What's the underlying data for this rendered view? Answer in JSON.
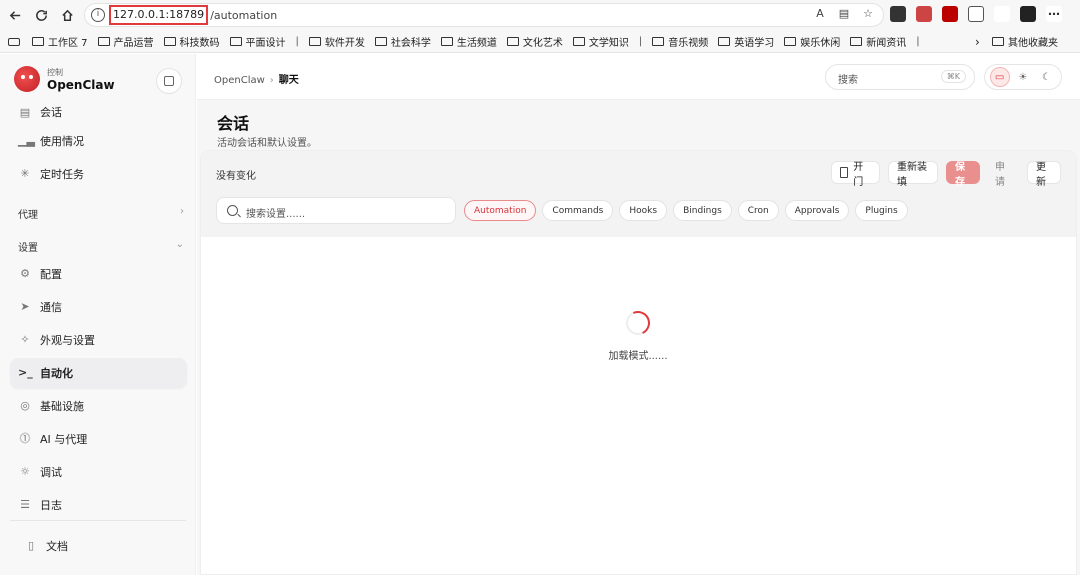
{
  "browser": {
    "url_host": "127.0.0.1:18789",
    "url_path": "/automation",
    "bookmarks": [
      {
        "label": "工作区 7",
        "folder": true
      },
      {
        "label": "产品运营",
        "folder": true
      },
      {
        "label": "科技数码",
        "folder": true
      },
      {
        "label": "平面设计",
        "folder": true
      },
      {
        "label": "|",
        "folder": false
      },
      {
        "label": "软件开发",
        "folder": true
      },
      {
        "label": "社会科学",
        "folder": true
      },
      {
        "label": "生活频道",
        "folder": true
      },
      {
        "label": "文化艺术",
        "folder": true
      },
      {
        "label": "文学知识",
        "folder": true
      },
      {
        "label": "|",
        "folder": false
      },
      {
        "label": "音乐视频",
        "folder": true
      },
      {
        "label": "英语学习",
        "folder": true
      },
      {
        "label": "娱乐休闲",
        "folder": true
      },
      {
        "label": "新闻资讯",
        "folder": true
      },
      {
        "label": "|",
        "folder": false
      }
    ],
    "other_bookmarks": "其他收藏夹"
  },
  "sidebar": {
    "brand_sub": "控制",
    "brand_name": "OpenClaw",
    "items_top": [
      {
        "label": "会话",
        "icon": "doc-icon"
      },
      {
        "label": "使用情况",
        "icon": "bar-chart-icon"
      },
      {
        "label": "定时任务",
        "icon": "loader-icon"
      }
    ],
    "section_agent": "代理",
    "section_settings": "设置",
    "items_settings": [
      {
        "label": "配置",
        "icon": "gear-icon"
      },
      {
        "label": "通信",
        "icon": "send-icon"
      },
      {
        "label": "外观与设置",
        "icon": "sparkle-icon"
      },
      {
        "label": "自动化",
        "icon": "terminal-icon"
      },
      {
        "label": "基础设施",
        "icon": "globe-icon"
      },
      {
        "label": "AI 与代理",
        "icon": "ai-icon"
      },
      {
        "label": "调试",
        "icon": "bug-icon"
      },
      {
        "label": "日志",
        "icon": "log-icon"
      }
    ],
    "docs": "文档"
  },
  "header": {
    "crumb_root": "OpenClaw",
    "crumb_current": "聊天",
    "search_placeholder": "搜索",
    "search_kbd": "⌘K"
  },
  "page": {
    "title": "会话",
    "subtitle": "活动会话和默认设置。"
  },
  "toolbar": {
    "status": "没有变化",
    "open_label": "开门",
    "reload_label": "重新装填",
    "save_label": "保存",
    "apply_label": "申请",
    "update_label": "更新",
    "settings_search_placeholder": "搜索设置......"
  },
  "chips": [
    "Automation",
    "Commands",
    "Hooks",
    "Bindings",
    "Cron",
    "Approvals",
    "Plugins"
  ],
  "loading_text": "加载模式......",
  "colors": {
    "accent": "#e0393e",
    "save_bg": "#e9908f"
  }
}
